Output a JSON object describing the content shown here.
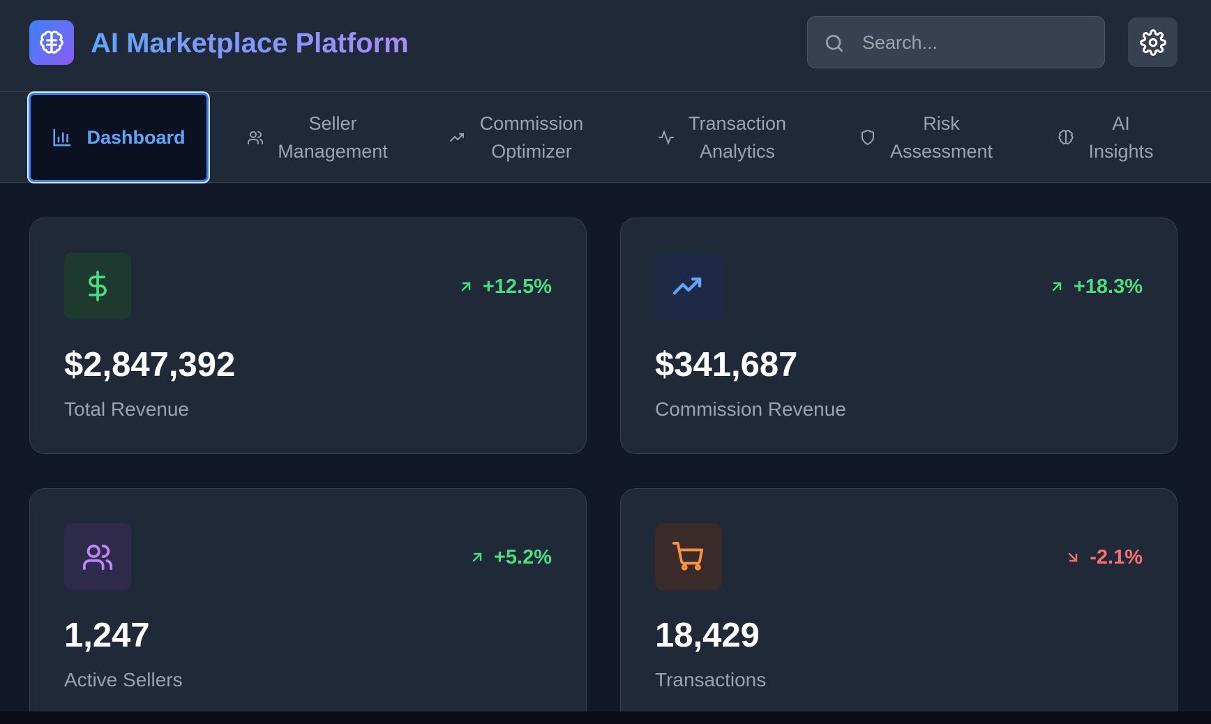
{
  "header": {
    "title": "AI Marketplace Platform",
    "search_placeholder": "Search...",
    "logo_icon": "brain-icon",
    "settings_icon": "gear-icon"
  },
  "tabs": [
    {
      "label": "Dashboard",
      "icon": "bar-chart-icon",
      "active": true
    },
    {
      "label": "Seller\nManagement",
      "icon": "users-icon"
    },
    {
      "label": "Commission\nOptimizer",
      "icon": "trending-up-icon"
    },
    {
      "label": "Transaction\nAnalytics",
      "icon": "activity-icon"
    },
    {
      "label": "Risk\nAssessment",
      "icon": "shield-icon"
    },
    {
      "label": "AI\nInsights",
      "icon": "brain-icon"
    }
  ],
  "stats": [
    {
      "value": "$2,847,392",
      "label": "Total Revenue",
      "delta": "+12.5%",
      "trend": "up",
      "icon": "dollar-icon"
    },
    {
      "value": "$341,687",
      "label": "Commission Revenue",
      "delta": "+18.3%",
      "trend": "up",
      "icon": "trending-up-icon"
    },
    {
      "value": "1,247",
      "label": "Active Sellers",
      "delta": "+5.2%",
      "trend": "up",
      "icon": "users-icon"
    },
    {
      "value": "18,429",
      "label": "Transactions",
      "delta": "-2.1%",
      "trend": "down",
      "icon": "shopping-cart-icon"
    }
  ],
  "colors": {
    "background": "#111827",
    "panel": "#1f2937",
    "accent": "#3b82f6",
    "positive": "#4ade80",
    "negative": "#f87171"
  }
}
